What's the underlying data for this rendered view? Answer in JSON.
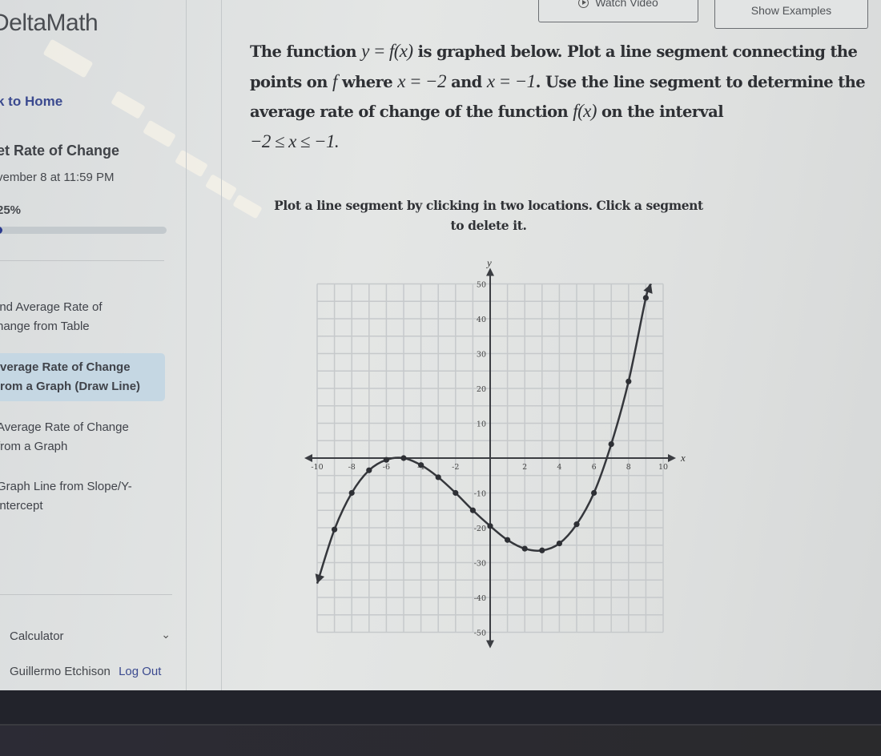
{
  "app": {
    "logo": "DeltaMath"
  },
  "sidebar": {
    "back_link": "k to Home",
    "assignment_title": "et Rate of Change",
    "due": "vember 8 at 11:59 PM",
    "progress_label": "25%",
    "progress_fraction_visible": 0.06,
    "skills": [
      {
        "line1": "ind Average Rate of",
        "line2": "hange from Table",
        "active": false
      },
      {
        "line1": "verage Rate of Change",
        "line2": "rom a Graph (Draw Line)",
        "active": true
      },
      {
        "line1": "Average Rate of Change",
        "line2": "from a Graph",
        "active": false
      },
      {
        "line1": "Graph Line from Slope/Y-",
        "line2": "intercept",
        "active": false
      }
    ],
    "calculator_label": "Calculator",
    "user_name": "Guillermo Etchison",
    "logout_label": "Log Out"
  },
  "toolbar": {
    "watch_video_label": "Watch Video",
    "show_examples_label": "Show Examples"
  },
  "question": {
    "t1": "The function ",
    "m1": "y = f(x)",
    "t2": " is graphed below. Plot a line segment connecting the points on ",
    "m2": "f",
    "t3": " where ",
    "m3": "x = −2",
    "t4": " and ",
    "m4": "x = −1",
    "t5": ". Use the line segment to determine the average rate of change of the function ",
    "m5": "f(x)",
    "t6": " on the interval ",
    "m6": "−2 ≤ x ≤ −1."
  },
  "instructions": "Plot a line segment by clicking in two locations. Click a segment to delete it.",
  "colors": {
    "accent": "#3b4a8f",
    "active_skill_bg": "#c5d7e3",
    "progress_fill": "#2b3a8f"
  },
  "chart_data": {
    "type": "line",
    "title": "",
    "xlabel": "x",
    "ylabel": "y",
    "xlim": [
      -10,
      10
    ],
    "ylim": [
      -50,
      50
    ],
    "grid": true,
    "x_ticks": [
      -10,
      -8,
      -6,
      -4,
      -2,
      2,
      4,
      6,
      8,
      10
    ],
    "y_ticks": [
      50,
      40,
      30,
      20,
      10,
      -10,
      -20,
      -30,
      -40,
      -50
    ],
    "x_grid_step": 1,
    "y_grid_step": 5,
    "series": [
      {
        "name": "f(x)",
        "x": [
          -9,
          -8,
          -7,
          -6,
          -5,
          -4,
          -3,
          -2,
          -1,
          0,
          1,
          2,
          3,
          4,
          5,
          6,
          7,
          8,
          9
        ],
        "y": [
          -20.5,
          -10,
          -3.5,
          -0.5,
          0,
          -2,
          -5.5,
          -10,
          -15,
          -19.5,
          -23.5,
          -26,
          -26.5,
          -24.5,
          -19,
          -10,
          4,
          22,
          46
        ],
        "left_end": [
          -10,
          -36
        ],
        "right_end": [
          9.3,
          50
        ]
      }
    ]
  }
}
